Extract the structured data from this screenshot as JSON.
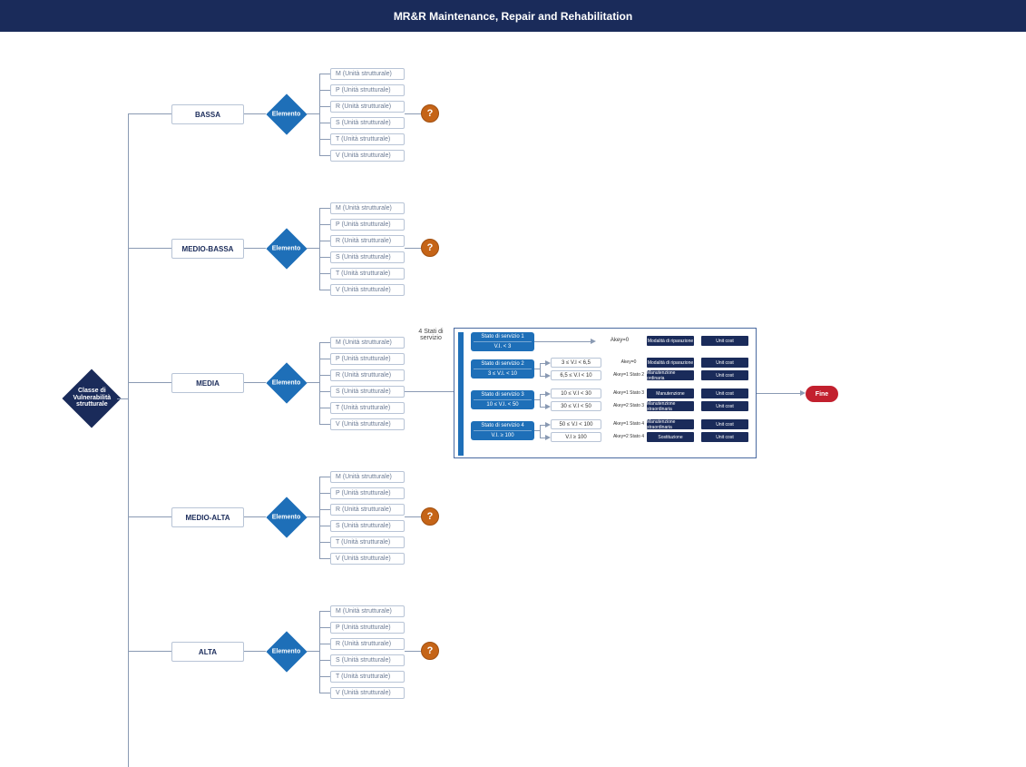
{
  "header": {
    "title": "MR&R Maintenance, Repair and Rehabilitation"
  },
  "root_decision": "Classe di Vulnerabilità strutturale",
  "classes": [
    "BASSA",
    "MEDIO-BASSA",
    "MEDIA",
    "MEDIO-ALTA",
    "ALTA"
  ],
  "elemento_label": "Elemento",
  "units": [
    "M (Unità strutturale)",
    "P (Unità strutturale)",
    "R (Unità strutturale)",
    "S (Unità strutturale)",
    "T (Unità strutturale)",
    "V (Unità strutturale)"
  ],
  "question_badge": "?",
  "panel": {
    "side_label": "4 Stati di servizio",
    "states": [
      {
        "title": "Stato di servizio 1",
        "range": "V.I. < 3",
        "rows": [
          {
            "cond": "",
            "akey": "Akey=0",
            "action": "Modalità di riparazione",
            "cost": "Unit cost"
          }
        ]
      },
      {
        "title": "Stato di servizio 2",
        "range": "3 ≤ V.I. < 10",
        "rows": [
          {
            "cond": "3 ≤ V.I < 6,5",
            "akey": "Akey=0",
            "action": "Modalità di riparazione",
            "cost": "Unit cost"
          },
          {
            "cond": "6,5 ≤ V.I < 10",
            "akey": "Akey=1 Stato 2",
            "action": "Manutenzione ordinaria",
            "cost": "Unit cost"
          }
        ]
      },
      {
        "title": "Stato di servizio 3",
        "range": "10 ≤ V.I. < 50",
        "rows": [
          {
            "cond": "10 ≤ V.I < 30",
            "akey": "Akey=1 Stato 3",
            "action": "Manutenzione",
            "cost": "Unit cost"
          },
          {
            "cond": "30 ≤ V.I < 50",
            "akey": "Akey=2 Stato 3",
            "action": "Manutenzione straordinaria",
            "cost": "Unit cost"
          }
        ]
      },
      {
        "title": "Stato di servizio 4",
        "range": "V.I. ≥ 100",
        "rows": [
          {
            "cond": "50 ≤ V.I < 100",
            "akey": "Akey=1 Stato 4",
            "action": "Manutenzione straordinaria",
            "cost": "Unit cost"
          },
          {
            "cond": "V.I ≥ 100",
            "akey": "Akey=2 Stato 4",
            "action": "Sostituzione",
            "cost": "Unit cost"
          }
        ]
      }
    ]
  },
  "fine": "Fine"
}
